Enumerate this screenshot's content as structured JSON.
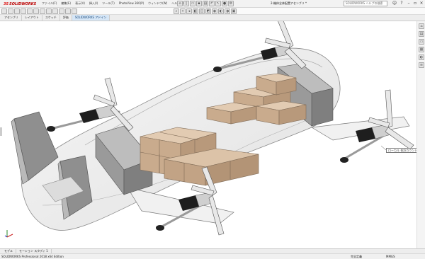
{
  "app": {
    "logo_ds": "3S",
    "logo_text": "SOLIDWORKS"
  },
  "menu": [
    "ファイル(F)",
    "編集(E)",
    "表示(V)",
    "挿入(I)",
    "ツール(T)",
    "PhotoView 360(P)",
    "ウィンドウ(W)",
    "ヘルプ(H)"
  ],
  "document_title": "2-機体全体配置アセンブリ *",
  "search_placeholder": "SOLIDWORKS ヘルプの検索",
  "command_tabs": [
    "アセンブリ",
    "レイアウト",
    "スケッチ",
    "評価",
    "SOLIDWORKS アドイン"
  ],
  "model_tabs": [
    "モデル",
    "モーション スタディ 1"
  ],
  "tooltip": "ローカル 合計カウント",
  "status": {
    "product": "SOLIDWORKS Professional 2018 x64 Edition",
    "state": "完全定義",
    "units": "MMGS"
  },
  "colors": {
    "cargo": "#d2b69a",
    "motor_gray": "#8a8a8a",
    "fuselage_fill": "#eaeaea",
    "active_tab": "#d6e6f6"
  }
}
